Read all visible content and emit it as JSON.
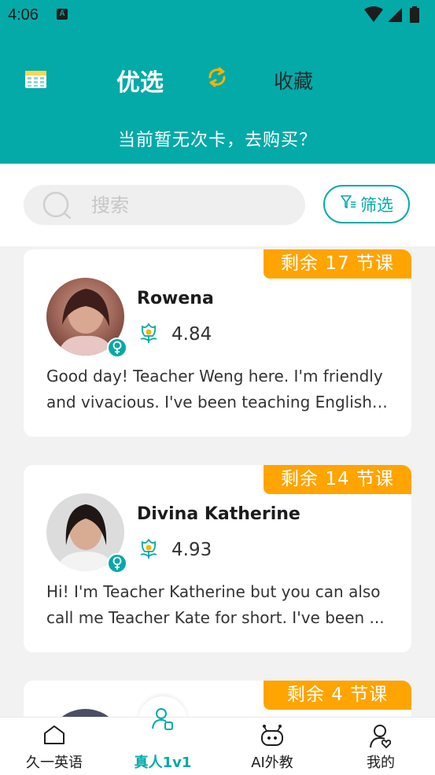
{
  "status": {
    "time": "4:06"
  },
  "header": {
    "tab_selected": "优选",
    "tab_favorites": "收藏",
    "card_notice": "当前暂无次卡，去购买？"
  },
  "search": {
    "placeholder": "搜索",
    "filter_label": "筛选"
  },
  "teachers": [
    {
      "name": "Rowena",
      "rating": "4.84",
      "remaining": "剩余 17 节课",
      "bio": "Good day! Teacher Weng here. I'm friendly and vivacious. I've been teaching English ..."
    },
    {
      "name": "Divina Katherine",
      "rating": "4.93",
      "remaining": "剩余 14 节课",
      "bio": "Hi! I'm Teacher Katherine but you can also call me Teacher Kate for short. I've been ..."
    },
    {
      "remaining": "剩余 4 节课"
    }
  ],
  "nav": [
    {
      "label": "久一英语"
    },
    {
      "label": "真人1v1"
    },
    {
      "label": "AI外教"
    },
    {
      "label": "我的"
    }
  ],
  "colors": {
    "primary": "#03aaa8",
    "badge": "#ffa400",
    "refresh": "#f5b400"
  }
}
